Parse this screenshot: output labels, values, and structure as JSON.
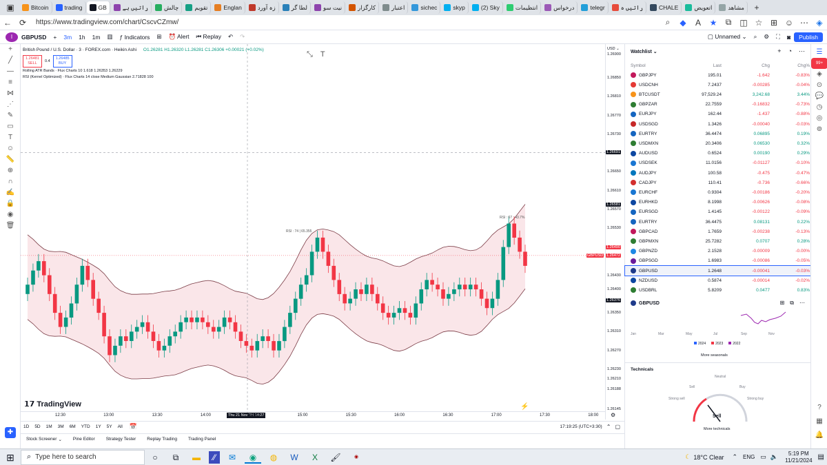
{
  "browser": {
    "tabs": [
      {
        "label": "Bitcoin",
        "active": false
      },
      {
        "label": "trading",
        "active": false
      },
      {
        "label": "GB",
        "active": true
      },
      {
        "label": "راتیں ہے",
        "active": false
      },
      {
        "label": "چالش",
        "active": false
      },
      {
        "label": "تقویم",
        "active": false
      },
      {
        "label": "Englan",
        "active": false
      },
      {
        "label": "زہ آورد",
        "active": false
      },
      {
        "label": "لطا گر",
        "active": false
      },
      {
        "label": "نیت سو",
        "active": false
      },
      {
        "label": "کارگزار",
        "active": false
      },
      {
        "label": "اعتبار",
        "active": false
      },
      {
        "label": "sichec",
        "active": false
      },
      {
        "label": "skyp",
        "active": false
      },
      {
        "label": "(2) Sky",
        "active": false
      },
      {
        "label": "انتظیمات",
        "active": false
      },
      {
        "label": "درخواس",
        "active": false
      },
      {
        "label": "telegr",
        "active": false
      },
      {
        "label": "راتیں ہ",
        "active": false
      },
      {
        "label": "CHALE",
        "active": false
      },
      {
        "label": "اتعویض",
        "active": false
      },
      {
        "label": "مشاهد",
        "active": false
      }
    ],
    "url": "https://www.tradingview.com/chart/CscvCZmw/"
  },
  "toolbar": {
    "symbol": "GBPUSD",
    "intervals": [
      "3m",
      "1h",
      "1m"
    ],
    "indicators": "Indicators",
    "alert": "Alert",
    "replay": "Replay",
    "layout": "Unnamed",
    "publish": "Publish"
  },
  "legend": {
    "title": "British Pound / U.S. Dollar · 3 · FOREX.com · Heikin Ashi",
    "ohlc": "O1.26281 H1.26320 L1.26281 C1.26306 +0.00021 (+0.02%)",
    "sell_price": "1.26481",
    "sell_label": "SELL",
    "spread": "0.4",
    "buy_price": "1.26485",
    "buy_label": "BUY",
    "ind1": "Rolling ATR Bands · Flux Charts 10 1.618 1.26353 1.26229",
    "ind2": "RSI (Kernel Optimized) · Flux Charts 14 close Medium Gaussian 2.71828 100",
    "ann1": "RSI : 74 | 65.355",
    "ann2": "RSI : 67 : 43.7%",
    "logo": "TradingView"
  },
  "chart_data": {
    "type": "candlestick",
    "title": "British Pound / U.S. Dollar · 3 · FOREX.com · Heikin Ashi",
    "ylim": [
      1.26145,
      1.2691
    ],
    "y_ticks": [
      "1.26900",
      "1.26850",
      "1.26810",
      "1.26770",
      "1.26730",
      "1.26690",
      "1.26650",
      "1.26610",
      "1.26570",
      "1.26530",
      "1.26490",
      "1.26430",
      "1.26400",
      "1.26350",
      "1.26310",
      "1.26270",
      "1.26230",
      "1.26210",
      "1.26188",
      "1.26145"
    ],
    "x_ticks": [
      "12:30",
      "13:00",
      "13:30",
      "14:00",
      "14:30",
      "15:00",
      "15:30",
      "16:00",
      "16:30",
      "17:00",
      "17:30",
      "18:00"
    ],
    "crosshair_time": "Thu 21 Nov '24  14:27",
    "price_tags": [
      {
        "label": "1.26691",
        "color": "#131722"
      },
      {
        "label": "1.26581",
        "color": "#131722"
      },
      {
        "label": "1.26490",
        "color": "#f23645"
      },
      {
        "label": "GBPUSD",
        "color": "#f23645"
      },
      {
        "label": "1.26472",
        "color": "#f23645"
      },
      {
        "label": "1.26376",
        "color": "#131722"
      }
    ],
    "candles": [
      [
        1.2639,
        1.2641
      ],
      [
        1.2641,
        1.2644
      ],
      [
        1.2644,
        1.2646
      ],
      [
        1.2646,
        1.2643
      ],
      [
        1.2643,
        1.2639
      ],
      [
        1.2639,
        1.2635
      ],
      [
        1.2635,
        1.2632
      ],
      [
        1.2632,
        1.2634
      ],
      [
        1.2634,
        1.2637
      ],
      [
        1.2637,
        1.2641
      ],
      [
        1.2641,
        1.2645
      ],
      [
        1.2645,
        1.2642
      ],
      [
        1.2642,
        1.2638
      ],
      [
        1.2638,
        1.2635
      ],
      [
        1.2635,
        1.263
      ],
      [
        1.263,
        1.2626
      ],
      [
        1.2626,
        1.2628
      ],
      [
        1.2628,
        1.263
      ],
      [
        1.263,
        1.2629
      ],
      [
        1.2629,
        1.2631
      ],
      [
        1.2631,
        1.2632
      ],
      [
        1.2632,
        1.2633
      ],
      [
        1.2633,
        1.2631
      ],
      [
        1.2631,
        1.2629
      ],
      [
        1.2629,
        1.2627
      ],
      [
        1.2627,
        1.2628
      ],
      [
        1.2628,
        1.263
      ],
      [
        1.263,
        1.2631
      ],
      [
        1.2631,
        1.2633
      ],
      [
        1.2633,
        1.2634
      ],
      [
        1.2634,
        1.2633
      ],
      [
        1.2633,
        1.2634
      ],
      [
        1.2634,
        1.2633
      ],
      [
        1.2633,
        1.2632
      ],
      [
        1.2632,
        1.2631
      ],
      [
        1.2631,
        1.2632
      ],
      [
        1.2632,
        1.2634
      ],
      [
        1.2634,
        1.2633
      ],
      [
        1.2633,
        1.2631
      ],
      [
        1.2631,
        1.2629
      ],
      [
        1.2629,
        1.2628
      ],
      [
        1.2628,
        1.2627
      ],
      [
        1.2627,
        1.2629
      ],
      [
        1.2629,
        1.263
      ],
      [
        1.263,
        1.2629
      ],
      [
        1.2629,
        1.2627
      ],
      [
        1.2627,
        1.2629
      ],
      [
        1.2629,
        1.2632
      ],
      [
        1.2632,
        1.2635
      ],
      [
        1.2635,
        1.2638
      ],
      [
        1.2638,
        1.2641
      ],
      [
        1.2641,
        1.2643
      ],
      [
        1.2643,
        1.2648
      ],
      [
        1.2648,
        1.2651
      ],
      [
        1.2651,
        1.2648
      ],
      [
        1.2648,
        1.2645
      ],
      [
        1.2645,
        1.2642
      ],
      [
        1.2642,
        1.2639
      ],
      [
        1.2639,
        1.2637
      ],
      [
        1.2637,
        1.2638
      ],
      [
        1.2638,
        1.264
      ],
      [
        1.264,
        1.2639
      ],
      [
        1.2639,
        1.2641
      ],
      [
        1.2641,
        1.2639
      ],
      [
        1.2639,
        1.2637
      ],
      [
        1.2637,
        1.2635
      ],
      [
        1.2635,
        1.2634
      ],
      [
        1.2634,
        1.2635
      ],
      [
        1.2635,
        1.2636
      ],
      [
        1.2636,
        1.2635
      ],
      [
        1.2635,
        1.2634
      ],
      [
        1.2634,
        1.2637
      ],
      [
        1.2637,
        1.264
      ],
      [
        1.264,
        1.2642
      ],
      [
        1.2642,
        1.2641
      ],
      [
        1.2641,
        1.264
      ],
      [
        1.264,
        1.2638
      ],
      [
        1.2638,
        1.2639
      ],
      [
        1.2639,
        1.264
      ],
      [
        1.264,
        1.2641
      ],
      [
        1.2641,
        1.264
      ],
      [
        1.264,
        1.2641
      ],
      [
        1.2641,
        1.264
      ],
      [
        1.264,
        1.2638
      ],
      [
        1.2638,
        1.2636
      ],
      [
        1.2636,
        1.2638
      ],
      [
        1.2638,
        1.2642
      ],
      [
        1.2642,
        1.2649
      ],
      [
        1.2649,
        1.2654
      ],
      [
        1.2654,
        1.2651
      ],
      [
        1.2651,
        1.2648
      ],
      [
        1.2648,
        1.2645
      ]
    ]
  },
  "axis_bottom": {
    "ranges": [
      "1D",
      "5D",
      "1M",
      "3M",
      "6M",
      "YTD",
      "1Y",
      "5Y",
      "All"
    ],
    "clock": "17:19:25 (UTC+3:30)"
  },
  "bottom_tabs": [
    "Stock Screener",
    "Pine Editor",
    "Strategy Tester",
    "Replay Trading",
    "Trading Panel"
  ],
  "watchlist": {
    "title": "Watchlist",
    "headers": {
      "symbol": "Symbol",
      "last": "Last",
      "chg": "Chg",
      "chgp": "Chg%"
    },
    "rows": [
      {
        "sym": "GBPJPY",
        "last": "195.01",
        "chg": "-1.642",
        "chgp": "-0.83%",
        "color": "#f23645"
      },
      {
        "sym": "USDCNH",
        "last": "7.2437",
        "chg": "-0.00285",
        "chgp": "-0.04%",
        "color": "#f23645"
      },
      {
        "sym": "BTCUSDT",
        "last": "97,529.24",
        "chg": "3,242.68",
        "chgp": "3.44%",
        "color": "#089981"
      },
      {
        "sym": "GBPZAR",
        "last": "22.7559",
        "chg": "-0.16832",
        "chgp": "-0.73%",
        "color": "#f23645"
      },
      {
        "sym": "EURJPY",
        "last": "162.44",
        "chg": "-1.437",
        "chgp": "-0.88%",
        "color": "#f23645"
      },
      {
        "sym": "USDSGD",
        "last": "1.3426",
        "chg": "-0.00040",
        "chgp": "-0.03%",
        "color": "#f23645"
      },
      {
        "sym": "EURTRY",
        "last": "36.4474",
        "chg": "0.06895",
        "chgp": "0.19%",
        "color": "#089981"
      },
      {
        "sym": "USDMXN",
        "last": "20.3406",
        "chg": "0.06530",
        "chgp": "0.32%",
        "color": "#089981"
      },
      {
        "sym": "AUDUSD",
        "last": "0.6524",
        "chg": "0.00190",
        "chgp": "0.29%",
        "color": "#089981"
      },
      {
        "sym": "USDSEK",
        "last": "11.0156",
        "chg": "-0.01127",
        "chgp": "-0.10%",
        "color": "#f23645"
      },
      {
        "sym": "AUDJPY",
        "last": "100.58",
        "chg": "-0.475",
        "chgp": "-0.47%",
        "color": "#f23645"
      },
      {
        "sym": "CADJPY",
        "last": "110.41",
        "chg": "-0.736",
        "chgp": "-0.66%",
        "color": "#f23645"
      },
      {
        "sym": "EURCHF",
        "last": "0.9304",
        "chg": "-0.00186",
        "chgp": "-0.20%",
        "color": "#f23645"
      },
      {
        "sym": "EURHKD",
        "last": "8.1998",
        "chg": "-0.00626",
        "chgp": "-0.08%",
        "color": "#f23645"
      },
      {
        "sym": "EURSGD",
        "last": "1.4145",
        "chg": "-0.00122",
        "chgp": "-0.09%",
        "color": "#f23645"
      },
      {
        "sym": "EURTRY",
        "last": "36.4475",
        "chg": "0.08131",
        "chgp": "0.22%",
        "color": "#089981"
      },
      {
        "sym": "GBPCAD",
        "last": "1.7659",
        "chg": "-0.00238",
        "chgp": "-0.13%",
        "color": "#f23645"
      },
      {
        "sym": "GBPMXN",
        "last": "25.7282",
        "chg": "0.0707",
        "chgp": "0.28%",
        "color": "#089981"
      },
      {
        "sym": "GBPNZD",
        "last": "2.1528",
        "chg": "-0.00009",
        "chgp": "-0.00%",
        "color": "#f23645"
      },
      {
        "sym": "GBPSGD",
        "last": "1.6983",
        "chg": "-0.00086",
        "chgp": "-0.05%",
        "color": "#f23645"
      },
      {
        "sym": "GBPUSD",
        "last": "1.2648",
        "chg": "-0.00041",
        "chgp": "-0.03%",
        "color": "#f23645"
      },
      {
        "sym": "NZDUSD",
        "last": "0.5874",
        "chg": "-0.00014",
        "chgp": "-0.02%",
        "color": "#f23645"
      },
      {
        "sym": "USDBRL",
        "last": "5.8209",
        "chg": "0.0477",
        "chgp": "0.83%",
        "color": "#089981"
      }
    ],
    "detail_symbol": "GBPUSD",
    "season_months": [
      "Jan",
      "Mar",
      "May",
      "Jul",
      "Sep",
      "Nov"
    ],
    "season_legend": [
      "2024",
      "2023",
      "2022"
    ],
    "more_seasonals": "More seasonals",
    "technicals_title": "Technicals",
    "gauge_labels": [
      "Strong sell",
      "Sell",
      "Neutral",
      "Buy",
      "Strong buy"
    ],
    "gauge_value": "Sell",
    "more_technicals": "More technicals"
  },
  "taskbar": {
    "search": "Type here to search",
    "weather": "18°C  Clear",
    "lang": "ENG",
    "time": "5:19 PM",
    "date": "11/21/2024"
  }
}
